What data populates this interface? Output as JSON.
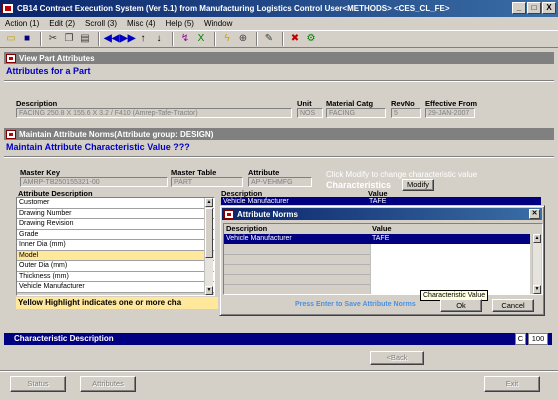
{
  "window": {
    "title": "CB14   Contract Execution System (Ver 5.1) from Manufacturing Logistics Control  User<METHODS>  <CES_CL_FE>",
    "buttons": [
      "_",
      "□",
      "X"
    ]
  },
  "menu": [
    "Action (1)",
    "Edit (2)",
    "Scroll (3)",
    "Misc (4)",
    "Help (5)",
    "Window"
  ],
  "toolbar_icons": [
    "folder-open-icon",
    "save-icon",
    "cut-icon",
    "copy-icon",
    "paste-icon",
    "first-record-icon",
    "last-record-icon",
    "up-arrow-icon",
    "down-arrow-icon",
    "query-icon",
    "excel-icon",
    "lightning-icon",
    "zoom-icon",
    "edit-note-icon",
    "delete-icon",
    "tools-icon"
  ],
  "view_part": {
    "panel_title": "View Part Attributes",
    "heading": "Attributes for a Part",
    "labels": {
      "description": "Description",
      "unit": "Unit",
      "material": "Material Catg",
      "revno": "RevNo",
      "effective": "Effective From"
    },
    "values": {
      "description": "FACING 250.8 X 155.6 X 3.2 / F410 (Amrep-Tafe-Tractor)",
      "unit": "NOS",
      "material": "FACING",
      "revno": "5",
      "effective": "29-JAN-2007"
    }
  },
  "norms": {
    "panel_title": "Maintain Attribute Norms(Attribute group: DESIGN)",
    "heading": "Maintain Attribute Characteristic Value ???",
    "labels": {
      "master_key": "Master Key",
      "master_table": "Master Table",
      "attribute": "Attribute"
    },
    "values": {
      "master_key": "AMRP-TB250155321-00",
      "master_table": "PART",
      "attribute": "AP-VEHMFG"
    },
    "hint": "Click Modify to change characteristic value",
    "characteristics_label": "Characteristics",
    "modify_label": "Modify",
    "attr_desc_header": "Attribute Description",
    "attributes": [
      "Customer",
      "Drawing Number",
      "Drawing Revision",
      "Grade",
      "Inner Dia (mm)",
      "Model",
      "Outer Dia (mm)",
      "Thickness (mm)",
      "Vehicle Manufacturer"
    ],
    "highlighted_attribute": "Model",
    "desc_header": "Description",
    "value_header": "Value",
    "bg_row": {
      "description": "Vehicle Manufacturer",
      "value": "TAFE"
    },
    "yellow_note": "Yellow Highlight indicates one or more cha"
  },
  "dialog": {
    "title": "Attribute Norms",
    "col_description": "Description",
    "col_value": "Value",
    "row": {
      "description": "Vehicle Manufacturer",
      "value": "TAFE"
    },
    "tooltip": "Characteristic Value",
    "enter_hint": "Press Enter to Save Attribute Norms",
    "ok_label": "Ok",
    "cancel_label": "Cancel"
  },
  "status": {
    "text": "Characteristic Description",
    "flag": "C",
    "count": "100"
  },
  "nav": {
    "back_label": "<Back"
  },
  "footer": {
    "status_label": "Status",
    "attributes_label": "Attributes",
    "exit_label": "Exit"
  }
}
